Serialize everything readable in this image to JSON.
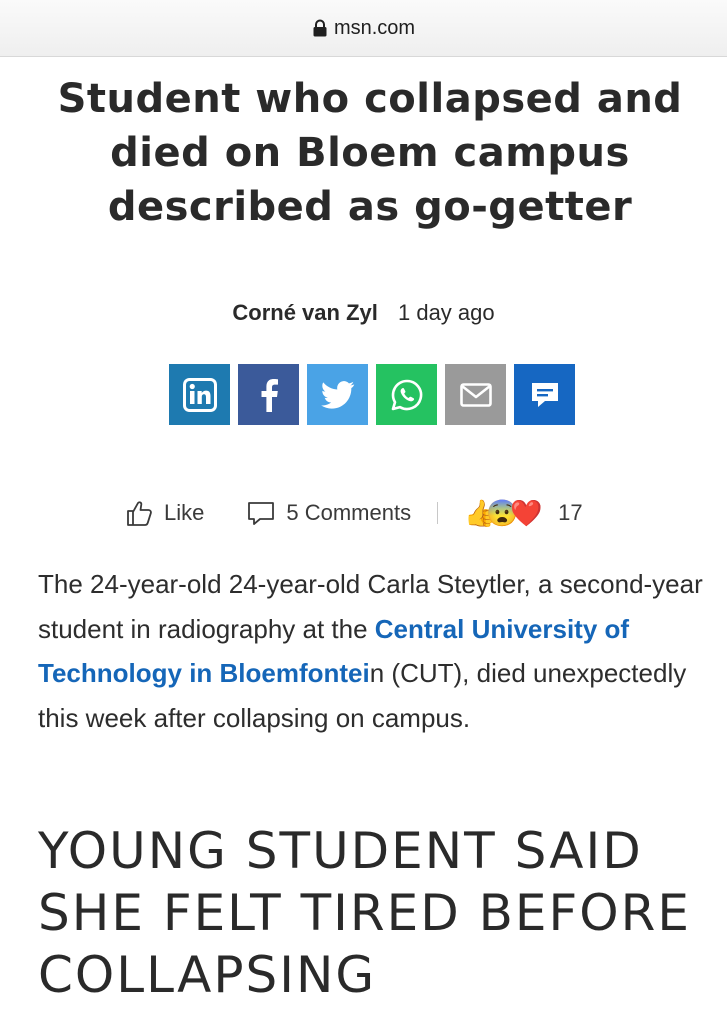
{
  "browser": {
    "url": "msn.com",
    "lock_icon": "lock-icon"
  },
  "article": {
    "headline": "Student who collapsed and died on Bloem campus described as go-getter",
    "author": "Corné van Zyl",
    "published": "1 day ago",
    "share_buttons": [
      {
        "name": "linkedin",
        "icon": "linkedin-icon",
        "color": "#1e7ab0"
      },
      {
        "name": "facebook",
        "icon": "facebook-icon",
        "color": "#3b5a9a"
      },
      {
        "name": "twitter",
        "icon": "twitter-icon",
        "color": "#4aa3e6"
      },
      {
        "name": "whatsapp",
        "icon": "whatsapp-icon",
        "color": "#25c261"
      },
      {
        "name": "email",
        "icon": "email-icon",
        "color": "#9a9a9a"
      },
      {
        "name": "comments",
        "icon": "comment-icon",
        "color": "#1667c2"
      }
    ],
    "reactions": {
      "like_label": "Like",
      "comments_label": "5 Comments",
      "reaction_emojis": [
        "👍",
        "😨",
        "❤️"
      ],
      "reaction_count": "17"
    },
    "paragraph": {
      "before": "The 24-year-old 24-year-old Carla Steytler, a second-year student in radiography at the ",
      "link": "Central University of Technology in Bloemfontei",
      "after": "n (CUT), died unexpectedly this week after collapsing on campus."
    },
    "subheading": "YOUNG STUDENT SAID SHE FELT TIRED BEFORE COLLAPSING",
    "link_color": "#1566b8"
  }
}
